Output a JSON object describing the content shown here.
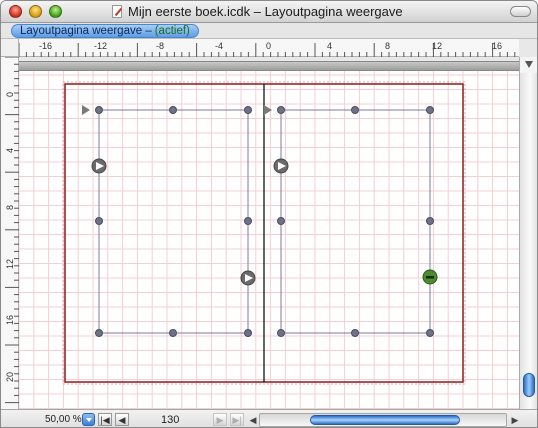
{
  "window": {
    "title": "Mijn eerste boek.icdk – Layoutpagina weergave"
  },
  "tab": {
    "label": "Layoutpagina weergave –",
    "status": "(actief)"
  },
  "ruler": {
    "h_labels": [
      "-16",
      "-12",
      "-8",
      "-4",
      "0",
      "4",
      "8",
      "12",
      "16"
    ],
    "v_labels": [
      "0",
      "4",
      "8",
      "12",
      "16",
      "20"
    ]
  },
  "status": {
    "zoom": "50,00 %",
    "page_number": "130",
    "first_page_glyph": "|◀",
    "prev_page_glyph": "◀",
    "next_page_glyph": "▶",
    "last_page_glyph": "▶|",
    "scroll_left_glyph": "◀",
    "scroll_right_glyph": "▶"
  },
  "colors": {
    "selection": "#8b1a1a",
    "grid": "#f3cfd3",
    "frame": "#7b7b9c",
    "handle": "#6e7289",
    "accent": "#3a7fd6"
  },
  "icons": [
    "close-icon",
    "minimize-icon",
    "zoom-icon",
    "document-icon",
    "play-icon",
    "minus-icon"
  ]
}
